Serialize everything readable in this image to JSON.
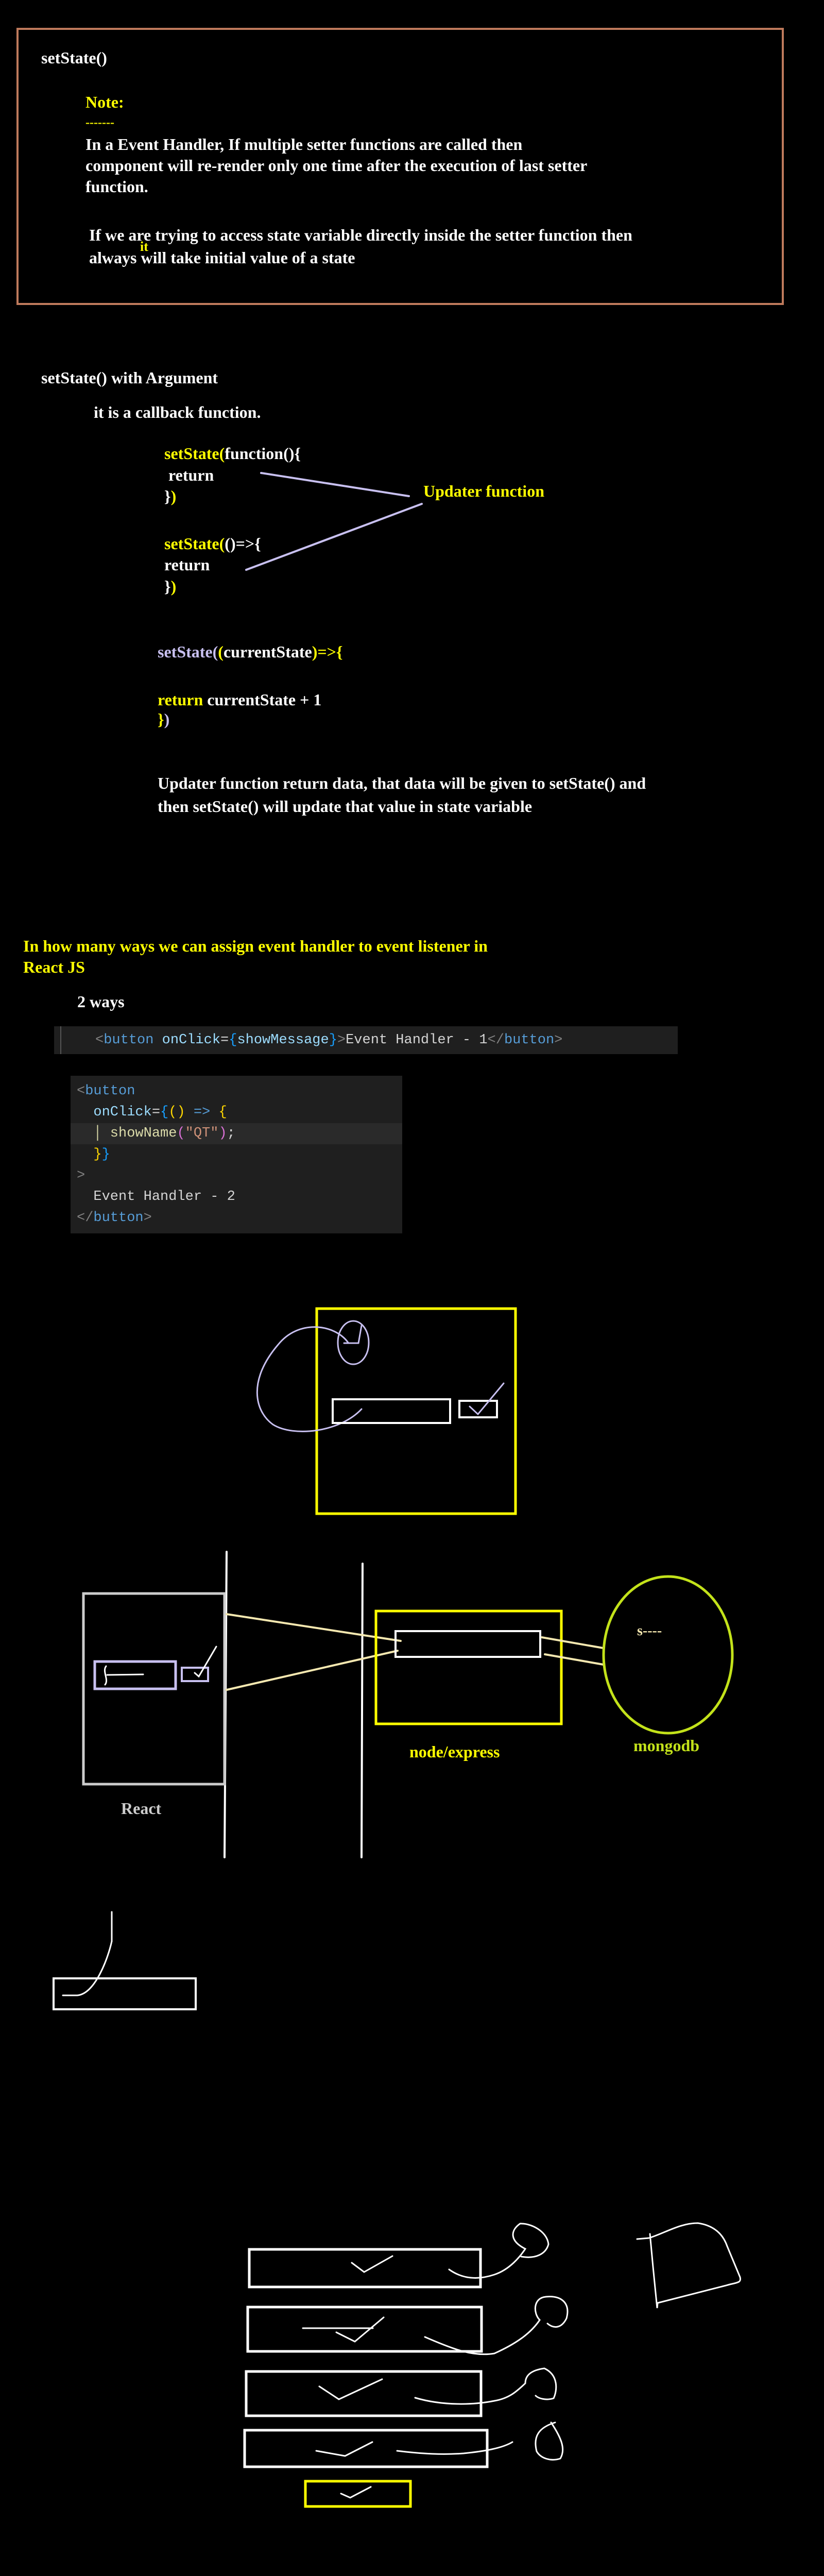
{
  "note_section": {
    "title": "setState()",
    "note_label": "Note:",
    "note_underline": "-------",
    "paragraph1": [
      "In a Event Handler, If multiple setter functions are called then",
      "component will re-render only one time after the execution of last setter",
      "function."
    ],
    "paragraph2_line1": "If we are trying to access state variable directly inside the setter function then",
    "paragraph2_line2_a": "always",
    "paragraph2_insert": "it",
    "paragraph2_line2_b": " will take initial value of a state"
  },
  "argument_section": {
    "title": "setState() with Argument",
    "subtitle": "it is a callback function.",
    "example1": {
      "call": "setState(",
      "fn": "function(){",
      "ret": " return",
      "close_a": "}",
      "close_b": ")"
    },
    "example2": {
      "call": "setState(",
      "fn": "()=>{",
      "ret": "return",
      "close_a": "}",
      "close_b": ")"
    },
    "updater_label": "Updater function",
    "example3": {
      "call": "setState(",
      "paren": "(",
      "param": "currentState",
      "arrow": ")=>{",
      "ret_kw": "return",
      "ret_expr": " currentState + 1",
      "close_a": "}",
      "close_b": ")"
    },
    "explanation": [
      "Updater function return data, that data will be given to setState() and",
      "then setState() will update that value in state variable"
    ]
  },
  "event_section": {
    "question": [
      "In how many ways we can assign event handler to event listener in",
      "React JS"
    ],
    "answer": "2 ways",
    "code1": [
      [
        [
          "<",
          "#808080"
        ],
        [
          "button",
          "#569cd6"
        ],
        [
          " ",
          ""
        ],
        [
          "onClick",
          "#9cdcfe"
        ],
        [
          "=",
          "#d4d4d4"
        ],
        [
          "{",
          "#179fff"
        ],
        [
          "showMessage",
          "#9cdcfe"
        ],
        [
          "}",
          "#179fff"
        ],
        [
          ">",
          "#808080"
        ],
        [
          "Event Handler - 1",
          "#d4d4d4"
        ],
        [
          "</",
          "#808080"
        ],
        [
          "button",
          "#569cd6"
        ],
        [
          ">",
          "#808080"
        ]
      ]
    ],
    "code2": [
      [
        [
          "<",
          "#808080"
        ],
        [
          "button",
          "#569cd6"
        ]
      ],
      [
        [
          "  onClick",
          "#9cdcfe"
        ],
        [
          "=",
          "#d4d4d4"
        ],
        [
          "{",
          "#179fff"
        ],
        [
          "(",
          "#ffd700"
        ],
        [
          ")",
          "#ffd700"
        ],
        [
          " => ",
          "#569cd6"
        ],
        [
          "{",
          "#ffd700"
        ]
      ],
      [
        [
          "  │ showName",
          "#dcdcaa"
        ],
        [
          "(",
          "#da70d6"
        ],
        [
          "\"QT\"",
          "#ce9178"
        ],
        [
          ")",
          "#da70d6"
        ],
        [
          ";",
          "#d4d4d4"
        ]
      ],
      [
        [
          "  }",
          "#ffd700"
        ],
        [
          "}",
          "#179fff"
        ]
      ],
      [
        [
          ">",
          "#808080"
        ]
      ],
      [
        [
          "  Event Handler - 2",
          "#d4d4d4"
        ]
      ],
      [
        [
          "</",
          "#808080"
        ],
        [
          "button",
          "#569cd6"
        ],
        [
          ">",
          "#808080"
        ]
      ]
    ]
  },
  "diagram": {
    "react_label": "React",
    "server_label": "node/express",
    "db_label": "mongodb",
    "db_note": "s----"
  },
  "colors": {
    "note_border": "#bf7a5c",
    "accent_yellow": "#ffff00",
    "lavender": "#c8c0f0",
    "mongo_green": "#c3e21a"
  }
}
